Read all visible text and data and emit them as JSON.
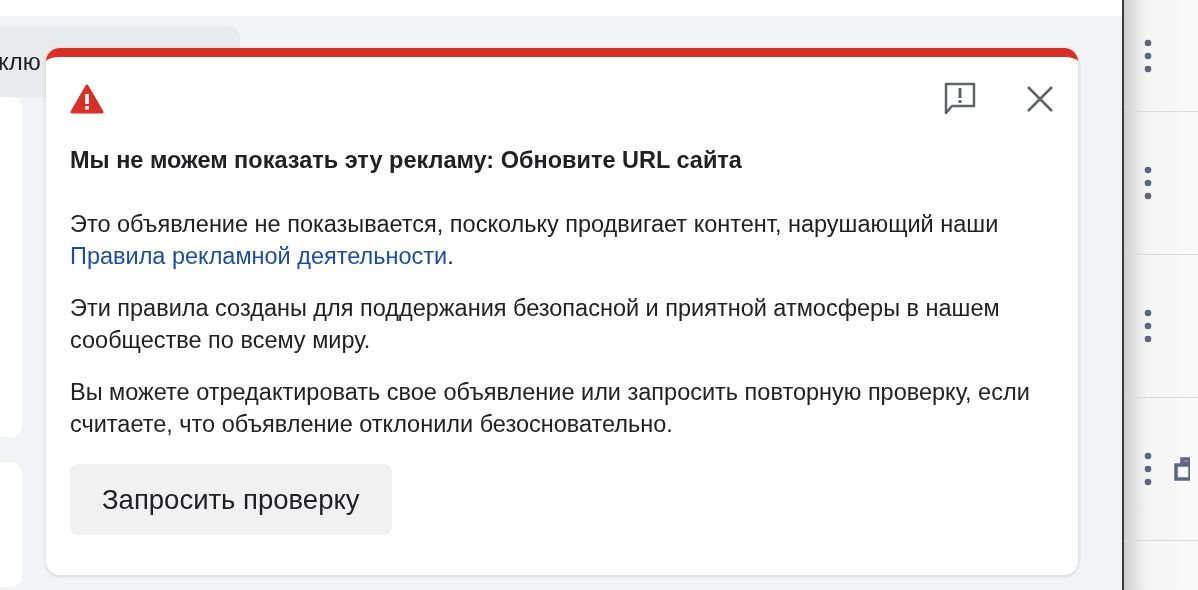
{
  "background": {
    "chip_text": "клю"
  },
  "right_rail": {
    "rows": [
      {
        "kind": "menu"
      },
      {
        "kind": "menu"
      },
      {
        "kind": "menu"
      },
      {
        "kind": "menu-with-icon"
      }
    ]
  },
  "dialog": {
    "critical": true,
    "title": "Мы не можем показать эту рекламу: Обновите URL сайта",
    "paragraphs": [
      [
        {
          "kind": "text",
          "text": "Это объявление не показывается, поскольку продвигает контент, нарушающий наши "
        },
        {
          "kind": "link",
          "text": "Правила рекламной деятельности"
        },
        {
          "kind": "text",
          "text": "."
        }
      ],
      [
        {
          "kind": "text",
          "text": "Эти правила созданы для поддержания безопасной и приятной атмосферы в нашем сообществе по всему миру."
        }
      ],
      [
        {
          "kind": "text",
          "text": "Вы можете отредактировать свое объявление или запросить повторную проверку, если считаете, что объявление отклонили безосновательно."
        }
      ]
    ],
    "button": "Запросить проверку"
  }
}
